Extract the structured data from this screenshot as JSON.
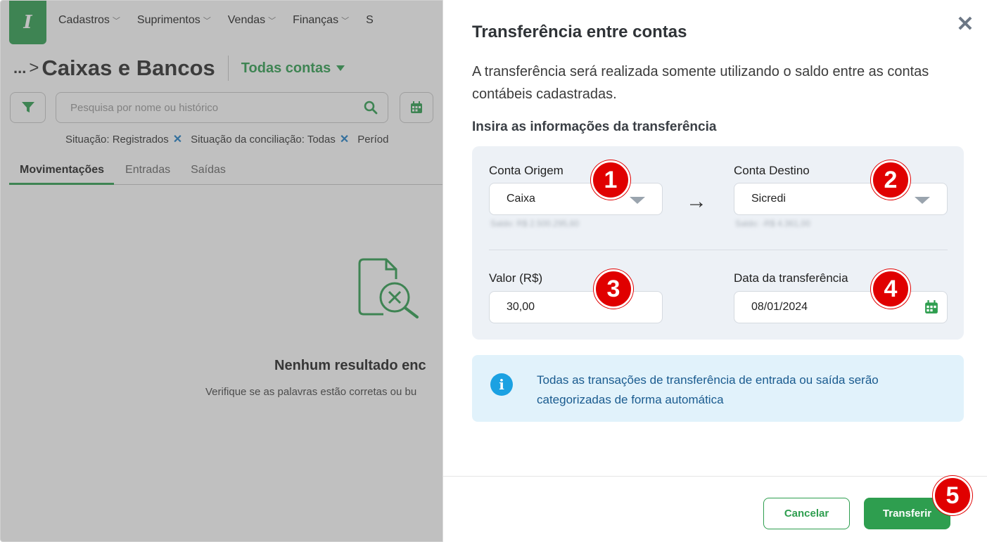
{
  "nav": {
    "logo": "I",
    "items": [
      {
        "label": "Cadastros"
      },
      {
        "label": "Suprimentos"
      },
      {
        "label": "Vendas"
      },
      {
        "label": "Finanças"
      },
      {
        "label": "S"
      }
    ]
  },
  "page": {
    "breadcrumb_ellipsis": "...",
    "breadcrumb_sep": ">",
    "title": "Caixas e Bancos",
    "account_filter": "Todas contas"
  },
  "search": {
    "placeholder": "Pesquisa por nome ou histórico"
  },
  "filters": [
    {
      "label": "Situação: Registrados"
    },
    {
      "label": "Situação da conciliação: Todas"
    },
    {
      "label": "Períod"
    }
  ],
  "tabs": [
    {
      "label": "Movimentações"
    },
    {
      "label": "Entradas"
    },
    {
      "label": "Saídas"
    }
  ],
  "empty_state": {
    "title": "Nenhum resultado enc",
    "description": "Verifique se as palavras estão corretas ou bu"
  },
  "modal": {
    "title": "Transferência entre contas",
    "description": "A transferência será realizada somente utilizando o saldo entre as contas contábeis cadastradas.",
    "section_title": "Insira as informações da transferência",
    "origin": {
      "label": "Conta Origem",
      "value": "Caixa",
      "balance": "Saldo: R$ 2.500.295,60"
    },
    "destination": {
      "label": "Conta Destino",
      "value": "Sicredi",
      "balance": "Saldo: -R$ 4.361,00"
    },
    "amount": {
      "label": "Valor (R$)",
      "value": "30,00"
    },
    "date": {
      "label": "Data da transferência",
      "value": "08/01/2024"
    },
    "info": "Todas as transações de transferência de entrada ou saída serão categorizadas de forma automática",
    "cancel_label": "Cancelar",
    "submit_label": "Transferir",
    "close_symbol": "✕"
  },
  "steps": [
    "1",
    "2",
    "3",
    "4",
    "5"
  ],
  "colors": {
    "brand_green": "#2e9e4f",
    "step_red": "#e00000",
    "info_blue": "#1ba1e2"
  }
}
